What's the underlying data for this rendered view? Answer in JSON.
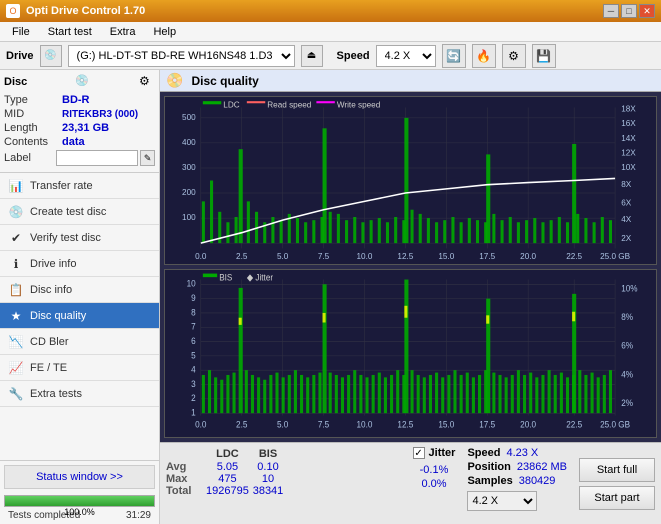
{
  "titleBar": {
    "title": "Opti Drive Control 1.70",
    "minimize": "─",
    "maximize": "□",
    "close": "✕"
  },
  "menuBar": {
    "items": [
      "File",
      "Start test",
      "Extra",
      "Help"
    ]
  },
  "driveBar": {
    "label": "Drive",
    "driveValue": "(G:)  HL-DT-ST BD-RE  WH16NS48 1.D3",
    "speedLabel": "Speed",
    "speedValue": "4.2 X"
  },
  "disc": {
    "title": "Disc",
    "typeLabel": "Type",
    "typeValue": "BD-R",
    "midLabel": "MID",
    "midValue": "RITEKBR3 (000)",
    "lengthLabel": "Length",
    "lengthValue": "23,31 GB",
    "contentsLabel": "Contents",
    "contentsValue": "data",
    "labelLabel": "Label"
  },
  "navItems": [
    {
      "id": "transfer-rate",
      "label": "Transfer rate",
      "icon": "📊"
    },
    {
      "id": "create-test-disc",
      "label": "Create test disc",
      "icon": "💿"
    },
    {
      "id": "verify-test-disc",
      "label": "Verify test disc",
      "icon": "✔"
    },
    {
      "id": "drive-info",
      "label": "Drive info",
      "icon": "ℹ"
    },
    {
      "id": "disc-info",
      "label": "Disc info",
      "icon": "📋"
    },
    {
      "id": "disc-quality",
      "label": "Disc quality",
      "icon": "★",
      "active": true
    },
    {
      "id": "cd-bler",
      "label": "CD Bler",
      "icon": "📉"
    },
    {
      "id": "fe-te",
      "label": "FE / TE",
      "icon": "📈"
    },
    {
      "id": "extra-tests",
      "label": "Extra tests",
      "icon": "🔧"
    }
  ],
  "status": {
    "windowBtn": "Status window >>",
    "progressValue": 100,
    "progressText": "100.0%",
    "statusText": "Tests completed",
    "timeText": "31:29"
  },
  "chartArea": {
    "title": "Disc quality",
    "icon": "📀",
    "legend": {
      "ldc": "LDC",
      "readSpeed": "Read speed",
      "writeSpeed": "Write speed"
    },
    "legend2": {
      "bis": "BIS",
      "jitter": "Jitter"
    },
    "xMax": "25.0 GB",
    "topChart": {
      "yMax": 500,
      "yLabels": [
        "500",
        "400",
        "300",
        "200",
        "100"
      ],
      "rightLabels": [
        "18X",
        "16X",
        "14X",
        "12X",
        "10X",
        "8X",
        "6X",
        "4X",
        "2X"
      ],
      "xLabels": [
        "0.0",
        "2.5",
        "5.0",
        "7.5",
        "10.0",
        "12.5",
        "15.0",
        "17.5",
        "20.0",
        "22.5",
        "25.0 GB"
      ]
    },
    "bottomChart": {
      "yMax": 10,
      "yLabels": [
        "10",
        "9",
        "8",
        "7",
        "6",
        "5",
        "4",
        "3",
        "2",
        "1"
      ],
      "rightLabels": [
        "10%",
        "8%",
        "6%",
        "4%",
        "2%"
      ],
      "xLabels": [
        "0.0",
        "2.5",
        "5.0",
        "7.5",
        "10.0",
        "12.5",
        "15.0",
        "17.5",
        "20.0",
        "22.5",
        "25.0 GB"
      ]
    }
  },
  "statsBar": {
    "columns": [
      "LDC",
      "BIS",
      "Jitter",
      "Speed"
    ],
    "rows": [
      {
        "label": "Avg",
        "ldc": "5.05",
        "bis": "0.10",
        "jitter": "-0.1%",
        "speed": "4.23 X"
      },
      {
        "label": "Max",
        "ldc": "475",
        "bis": "10",
        "jitter": "0.0%",
        "position": "23862 MB"
      },
      {
        "label": "Total",
        "ldc": "1926795",
        "bis": "38341",
        "jitter": ""
      }
    ],
    "jitterChecked": true,
    "speedSelectValue": "4.2 X",
    "samples": "380429",
    "startFullLabel": "Start full",
    "startPartLabel": "Start part"
  }
}
